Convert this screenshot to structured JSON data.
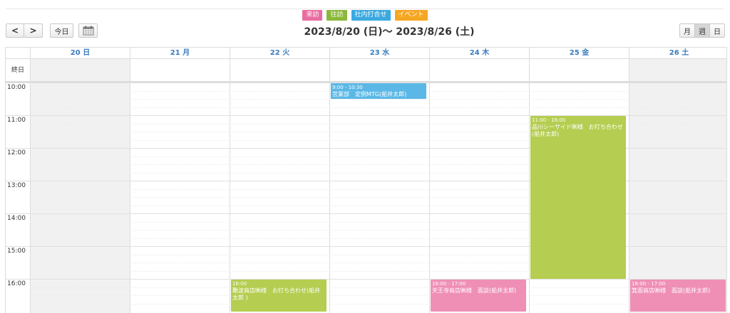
{
  "legend": [
    {
      "label": "来訪",
      "color": "#e86ea0"
    },
    {
      "label": "往訪",
      "color": "#8bb83a"
    },
    {
      "label": "社内打合せ",
      "color": "#3aa9e0"
    },
    {
      "label": "イベント",
      "color": "#f5a623"
    }
  ],
  "toolbar": {
    "prev": "<",
    "next": ">",
    "today": "今日",
    "title": "2023/8/20 (日)～ 2023/8/26 (土)",
    "views": [
      "月",
      "週",
      "日"
    ],
    "active_view": "週"
  },
  "allday_label": "終日",
  "days": [
    {
      "label": "20 日",
      "shaded": true
    },
    {
      "label": "21 月",
      "shaded": false
    },
    {
      "label": "22 火",
      "shaded": false
    },
    {
      "label": "23 水",
      "shaded": false
    },
    {
      "label": "24 木",
      "shaded": false
    },
    {
      "label": "25 金",
      "shaded": false
    },
    {
      "label": "26 土",
      "shaded": true
    }
  ],
  "hours": [
    "10:00",
    "11:00",
    "12:00",
    "13:00",
    "14:00",
    "15:00",
    "16:00"
  ],
  "events": [
    {
      "day": 3,
      "start": 10.0,
      "end": 10.5,
      "time": "9:00 - 10:30",
      "title": "営業部　定例MTG(船井太郎)",
      "color": "#5bb8e6"
    },
    {
      "day": 5,
      "start": 11.0,
      "end": 16.0,
      "time": "11:00 - 16:00",
      "title": "品川シーサイド㈱様　お打ち合わせ(船井太郎)",
      "color": "#b5cd50"
    },
    {
      "day": 2,
      "start": 16.0,
      "end": 17.0,
      "time": "16:00",
      "title": "難波商店㈱様　お打ち合わせ(船井太郎 )",
      "color": "#b5cd50"
    },
    {
      "day": 4,
      "start": 16.0,
      "end": 17.0,
      "time": "16:00 - 17:00",
      "title": "天王寺商店㈱様　面談(船井太郎)",
      "color": "#ef8fb6"
    },
    {
      "day": 6,
      "start": 16.0,
      "end": 17.0,
      "time": "16:00 - 17:00",
      "title": "箕面商店㈱様　面談(船井太郎)",
      "color": "#ef8fb6"
    }
  ]
}
